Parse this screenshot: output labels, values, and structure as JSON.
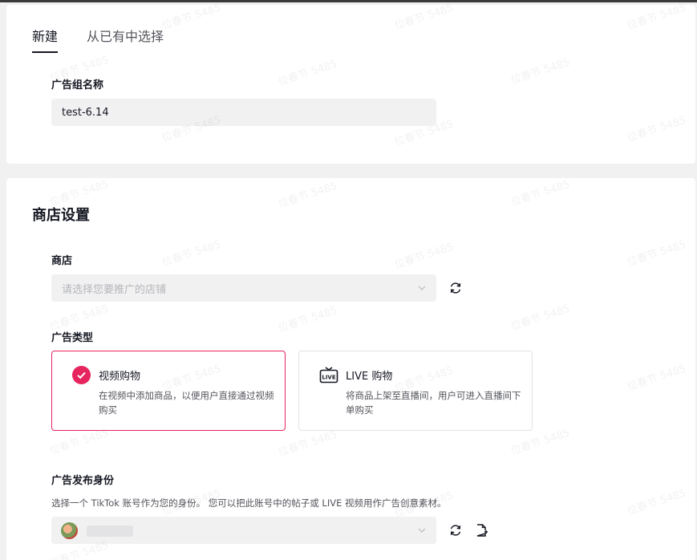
{
  "tabs": [
    {
      "label": "新建",
      "active": true
    },
    {
      "label": "从已有中选择",
      "active": false
    }
  ],
  "adgroup": {
    "name_label": "广告组名称",
    "name_value": "test-6.14"
  },
  "shop_settings": {
    "title": "商店设置",
    "shop_label": "商店",
    "shop_placeholder": "请选择您要推广的店铺",
    "ad_type_label": "广告类型",
    "options": [
      {
        "title": "视频购物",
        "desc": "在视频中添加商品，以便用户直接通过视频购买",
        "selected": true
      },
      {
        "title": "LIVE 购物",
        "desc": "将商品上架至直播间，用户可进入直播间下单购买",
        "selected": false
      }
    ],
    "identity_label": "广告发布身份",
    "identity_helper": "选择一个 TikTok 账号作为您的身份。 您可以把此账号中的帖子或 LIVE 视频用作广告创意素材。"
  },
  "watermark": {
    "name": "位春节 5485"
  },
  "colors": {
    "accent": "#e6245e",
    "input_bg": "#f1f1f2",
    "page_bg": "#f1f1f2"
  }
}
